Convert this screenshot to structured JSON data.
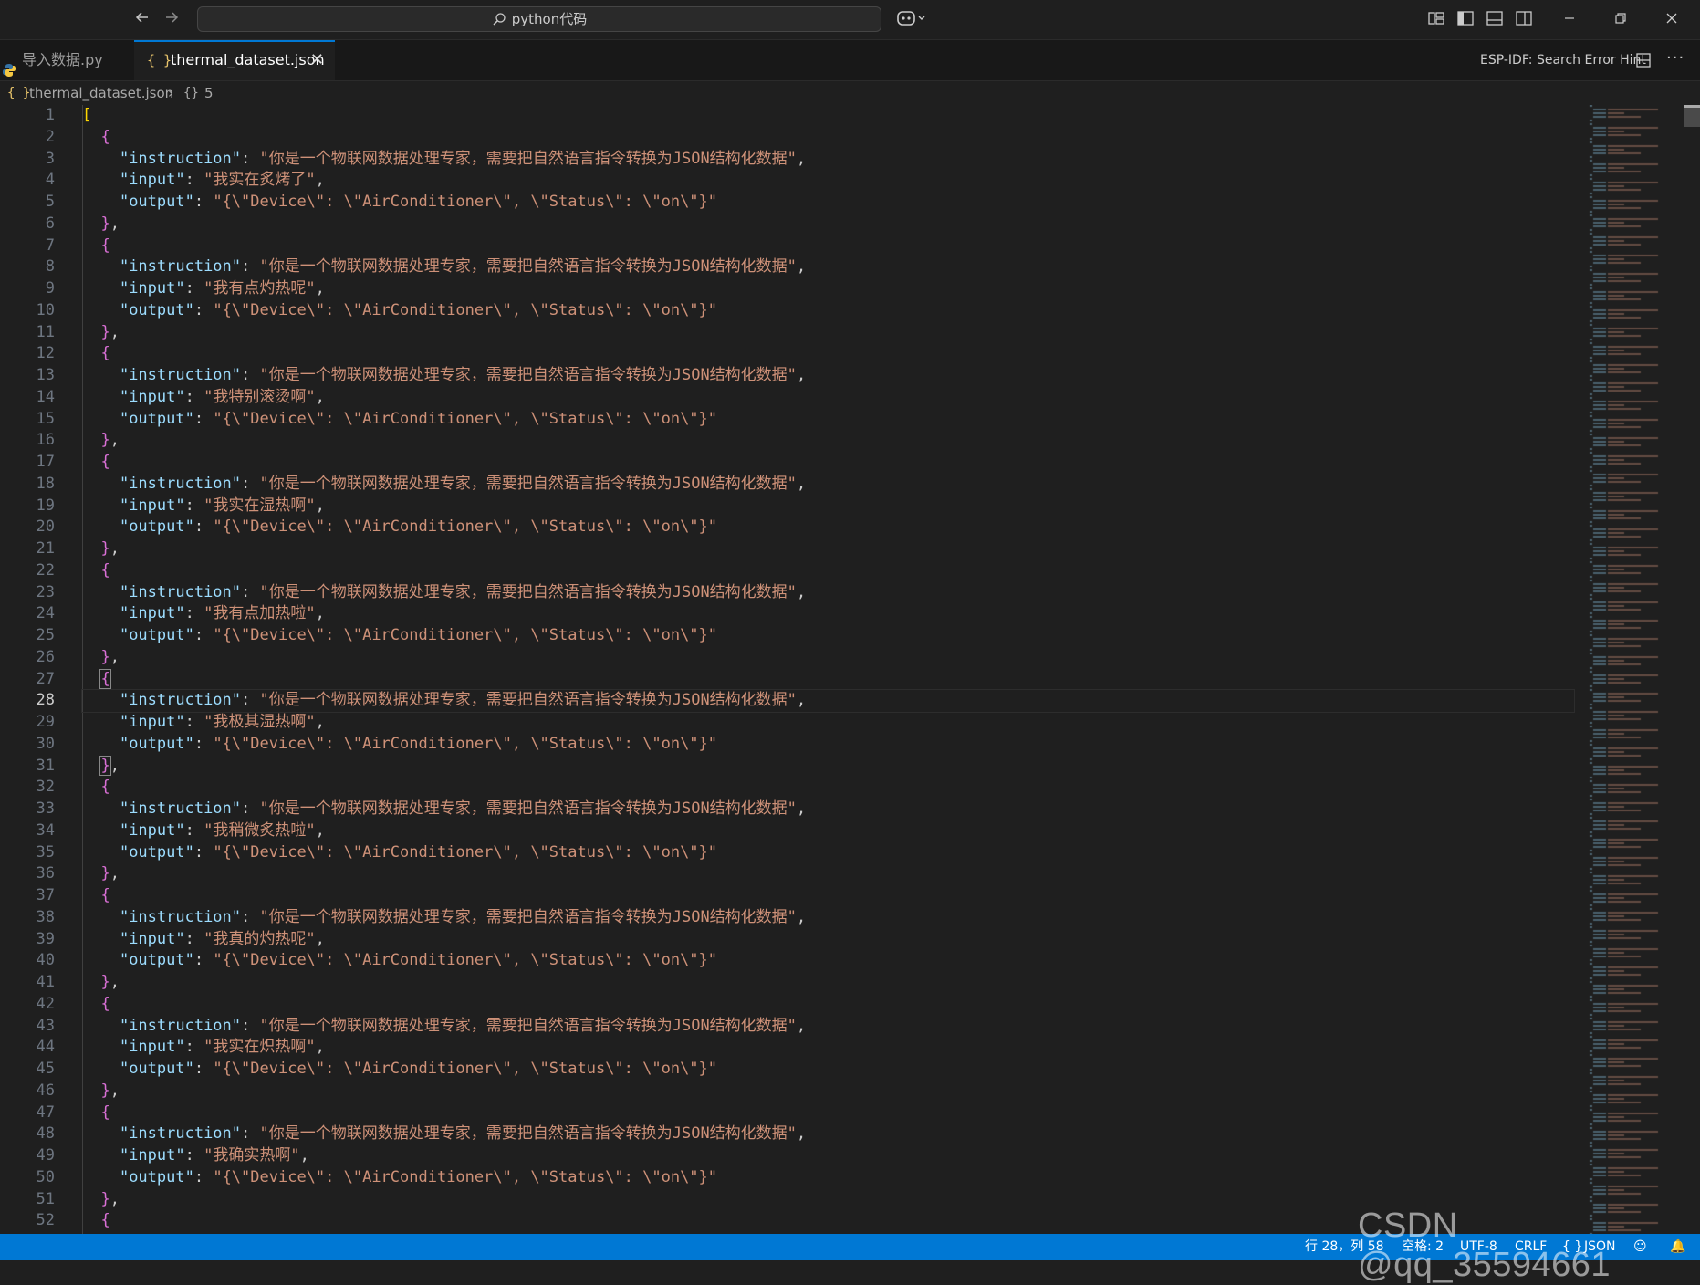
{
  "titlebar": {
    "back_icon": "arrow-left-icon",
    "forward_icon": "arrow-right-icon",
    "search_text": "python代码",
    "copilot_icon": "copilot-icon"
  },
  "tabs": [
    {
      "label": "导入数据.py",
      "icon": "python-file-icon",
      "active": false
    },
    {
      "label": "thermal_dataset.json",
      "icon": "json-file-icon",
      "active": true,
      "close": "✕"
    }
  ],
  "tab_actions": {
    "esp_hint": "ESP-IDF: Search Error Hint",
    "more": "···"
  },
  "breadcrumb": {
    "file": "thermal_dataset.json",
    "node": "5"
  },
  "editor": {
    "instruction_text": "你是一个物联网数据处理专家，需要把自然语言指令转换为JSON结构化数据",
    "output_text": "{\\\"Device\\\": \\\"AirConditioner\\\", \\\"Status\\\": \\\"on\\\"}",
    "inputs": [
      "我实在炙烤了",
      "我有点灼热呢",
      "我特别滚烫啊",
      "我实在湿热啊",
      "我有点加热啦",
      "我极其湿热啊",
      "我稍微炙热啦",
      "我真的灼热呢",
      "我实在炽热啊",
      "我确实热啊"
    ],
    "last_line_number": "52",
    "active_line": 28
  },
  "statusbar": {
    "position": "行 28，列 58",
    "spaces": "空格: 2",
    "encoding": "UTF-8",
    "eol": "CRLF",
    "language": "JSON",
    "watermark": "CSDN @qq_35594661"
  },
  "colors": {
    "accent": "#0078d4",
    "key": "#9cdcfe",
    "string": "#ce9178",
    "bracket1": "#ffd700",
    "bracket2": "#da70d6"
  }
}
